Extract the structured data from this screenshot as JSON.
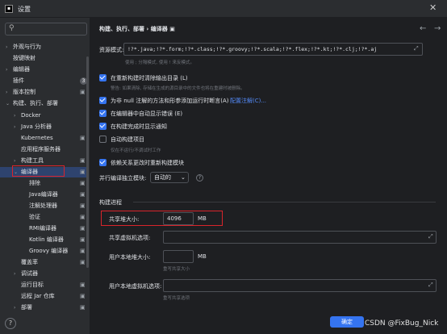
{
  "window": {
    "icon": "intellij-icon",
    "title": "设置",
    "close": "✕"
  },
  "sidebar": {
    "search_placeholder": "",
    "help": "?",
    "items": [
      {
        "label": "外观与行为",
        "chev": "›",
        "badge": ""
      },
      {
        "label": "按键映射",
        "chev": "",
        "badge": ""
      },
      {
        "label": "编辑器",
        "chev": "›",
        "badge": ""
      },
      {
        "label": "插件",
        "chev": "",
        "badge": "3"
      },
      {
        "label": "版本控制",
        "chev": "›",
        "badge": "▣"
      },
      {
        "label": "构建、执行、部署",
        "chev": "⌄",
        "badge": ""
      },
      {
        "label": "Docker",
        "chev": "›",
        "badge": ""
      },
      {
        "label": "Java 分析器",
        "chev": "›",
        "badge": ""
      },
      {
        "label": "Kubernetes",
        "chev": "",
        "badge": "▣"
      },
      {
        "label": "应用程序服务器",
        "chev": "",
        "badge": ""
      },
      {
        "label": "构建工具",
        "chev": "›",
        "badge": "▣"
      },
      {
        "label": "编译器",
        "chev": "⌄",
        "badge": "▣"
      },
      {
        "label": "排除",
        "chev": "",
        "badge": "▣"
      },
      {
        "label": "Java编译器",
        "chev": "",
        "badge": "▣"
      },
      {
        "label": "注解处理器",
        "chev": "",
        "badge": "▣"
      },
      {
        "label": "验证",
        "chev": "",
        "badge": "▣"
      },
      {
        "label": "RMI编译器",
        "chev": "",
        "badge": "▣"
      },
      {
        "label": "Kotlin 编译器",
        "chev": "",
        "badge": "▣"
      },
      {
        "label": "Groovy 编译器",
        "chev": "",
        "badge": "▣"
      },
      {
        "label": "覆盖率",
        "chev": "",
        "badge": "▣"
      },
      {
        "label": "调试器",
        "chev": "›",
        "badge": ""
      },
      {
        "label": "运行目标",
        "chev": "",
        "badge": "▣"
      },
      {
        "label": "远程 Jar 仓库",
        "chev": "",
        "badge": "▣"
      },
      {
        "label": "部署",
        "chev": "›",
        "badge": "▣"
      }
    ]
  },
  "content": {
    "breadcrumb": "构建、执行、部署  ›  编译器  ▣",
    "back": "←",
    "forward": "→",
    "resource_label": "资源模式:",
    "resource_value": "!?*.java;!?*.form;!?*.class;!?*.groovy;!?*.scala;!?*.flex;!?*.kt;!?*.clj;!?*.aj",
    "resource_hint": "使用 ; 分隔模式, 使用 ! 来反模式。",
    "opt1": "在重新构建时清除输出目录 (L)",
    "opt1_hint": "警告: 如果清除, 存储在生成的源目录中的文件也将在重建时被删除。",
    "opt2": "为非 null 注解的方法和形参添加运行时断言(A)",
    "opt2_link": "配置注解(C)...",
    "opt3": "在编辑器中自动显示错误 (E)",
    "opt4": "在构建完成时显示通知",
    "opt5": "自动构建项目",
    "opt5_hint": "仅在不运行/不调试时工作",
    "opt6": "依赖关系更改时重新构建模块",
    "parallel_label": "并行编译独立模块:",
    "parallel_value": "自动的",
    "parallel_chev": "⌄",
    "help_q": "?",
    "section": "构建进程",
    "heap_label": "共享堆大小:",
    "heap_value": "4096",
    "heap_unit": "MB",
    "shared_vm_label": "共享虚拟机选项:",
    "shared_vm_value": "",
    "user_heap_label": "用户本地堆大小:",
    "user_heap_value": "",
    "user_heap_unit": "MB",
    "user_heap_hint": "重写共享大小",
    "user_vm_label": "用户本地虚拟机选项:",
    "user_vm_value": "",
    "user_vm_hint": "重写共享选项",
    "expand": "⤢",
    "ok": "确定",
    "watermark": "CSDN @FixBug_Nick"
  },
  "colors": {
    "accent": "#3574f0",
    "highlight": "#d9242b",
    "link": "#548af7"
  }
}
